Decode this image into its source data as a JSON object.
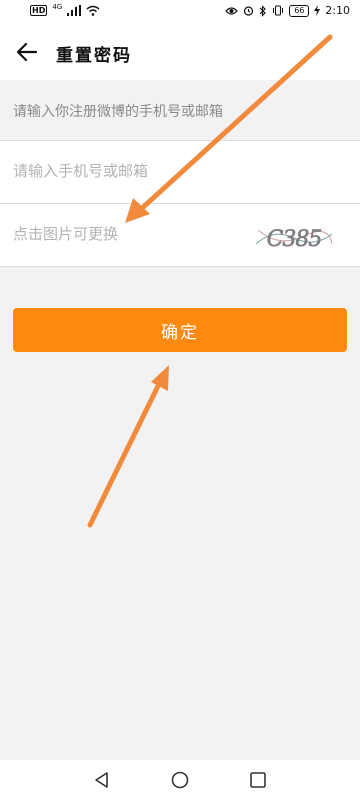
{
  "status_bar": {
    "left_badge": "HD",
    "network": "4G",
    "battery": "66",
    "time": "2:10"
  },
  "header": {
    "title": "重置密码",
    "back_icon": "arrow-left-icon"
  },
  "form": {
    "hint": "请输入你注册微博的手机号或邮箱",
    "phone_placeholder": "请输入手机号或邮箱",
    "captcha_placeholder": "点击图片可更换",
    "captcha_image_text": "C385"
  },
  "confirm_button": {
    "label": "确定",
    "color": "#ff8a0f"
  },
  "annotations": {
    "arrow_color": "#f28a3c"
  },
  "nav_bar": {
    "back_icon": "triangle-back-icon",
    "home_icon": "circle-home-icon",
    "recent_icon": "square-recent-icon"
  }
}
